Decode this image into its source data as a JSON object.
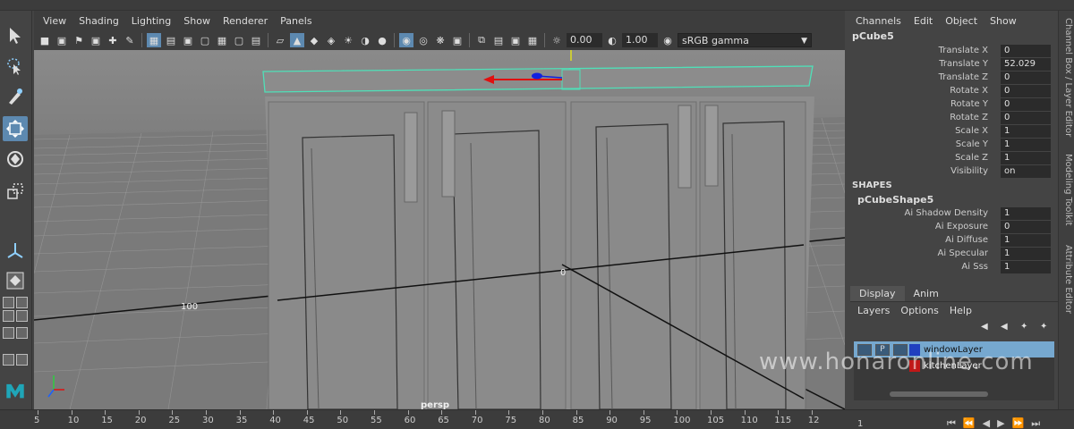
{
  "viewport": {
    "menus": [
      "View",
      "Shading",
      "Lighting",
      "Show",
      "Renderer",
      "Panels"
    ],
    "exposure": "0.00",
    "gamma": "1.00",
    "color_space": "sRGB gamma",
    "camera_label": "persp",
    "grid_label_left": "100",
    "origin_label": "0"
  },
  "channel_box": {
    "menus": [
      "Channels",
      "Edit",
      "Object",
      "Show"
    ],
    "object_name": "pCube5",
    "attributes": [
      {
        "label": "Translate X",
        "value": "0"
      },
      {
        "label": "Translate Y",
        "value": "52.029"
      },
      {
        "label": "Translate Z",
        "value": "0"
      },
      {
        "label": "Rotate X",
        "value": "0"
      },
      {
        "label": "Rotate Y",
        "value": "0"
      },
      {
        "label": "Rotate Z",
        "value": "0"
      },
      {
        "label": "Scale X",
        "value": "1"
      },
      {
        "label": "Scale Y",
        "value": "1"
      },
      {
        "label": "Scale Z",
        "value": "1"
      },
      {
        "label": "Visibility",
        "value": "on"
      }
    ],
    "shapes_header": "SHAPES",
    "shape_name": "pCubeShape5",
    "shape_attributes": [
      {
        "label": "Ai Shadow Density",
        "value": "1"
      },
      {
        "label": "Ai Exposure",
        "value": "0"
      },
      {
        "label": "Ai Diffuse",
        "value": "1"
      },
      {
        "label": "Ai Specular",
        "value": "1"
      },
      {
        "label": "Ai Sss",
        "value": "1"
      }
    ]
  },
  "side_tabs": [
    "Channel Box / Layer Editor",
    "Modeling Toolkit",
    "Attribute Editor"
  ],
  "layer_editor": {
    "tabs": [
      "Display",
      "Anim"
    ],
    "menus": [
      "Layers",
      "Options",
      "Help"
    ],
    "layers": [
      {
        "name": "windowLayer",
        "color": "#1f3fbf",
        "selected": true,
        "p_flag": "P"
      },
      {
        "name": "kitchenLayer",
        "color": "#c01818",
        "selected": false,
        "p_flag": ""
      }
    ]
  },
  "watermark": "www.honaronline.com",
  "time_slider": {
    "ticks": [
      "5",
      "10",
      "15",
      "20",
      "25",
      "30",
      "35",
      "40",
      "45",
      "50",
      "55",
      "60",
      "65",
      "70",
      "75",
      "80",
      "85",
      "90",
      "95",
      "100",
      "105",
      "110",
      "115",
      "12"
    ],
    "current_frame": "1"
  },
  "colors": {
    "selection_highlight": "#5d89b0",
    "layer_selected": "#76a8cf",
    "wireframe_selected": "#4fe0b8",
    "manipulator_x": "#e01010",
    "manipulator_z": "#1020e0"
  }
}
